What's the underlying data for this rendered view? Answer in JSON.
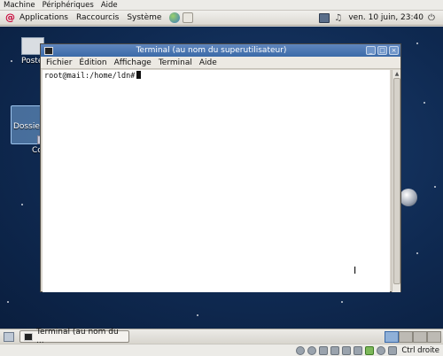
{
  "host_menu": {
    "items": [
      "Machine",
      "Périphériques",
      "Aide"
    ]
  },
  "top_panel": {
    "menus": [
      "Applications",
      "Raccourcis",
      "Système"
    ],
    "clock": "ven. 10 juin, 23:40"
  },
  "desktop": {
    "icons": [
      "Poste",
      "Dossier",
      "Co"
    ]
  },
  "terminal": {
    "title": "Terminal (au nom du superutilisateur)",
    "menu": [
      "Fichier",
      "Édition",
      "Affichage",
      "Terminal",
      "Aide"
    ],
    "prompt": "root@mail:/home/ldn#"
  },
  "taskbar": {
    "task_label": "Terminal (au nom du ..."
  },
  "vbox_status": {
    "host_key": "Ctrl droite"
  },
  "colors": {
    "titlebar": "#3b6aa8",
    "desktop_bg": "#0f2a52",
    "debian_red": "#c70036"
  }
}
